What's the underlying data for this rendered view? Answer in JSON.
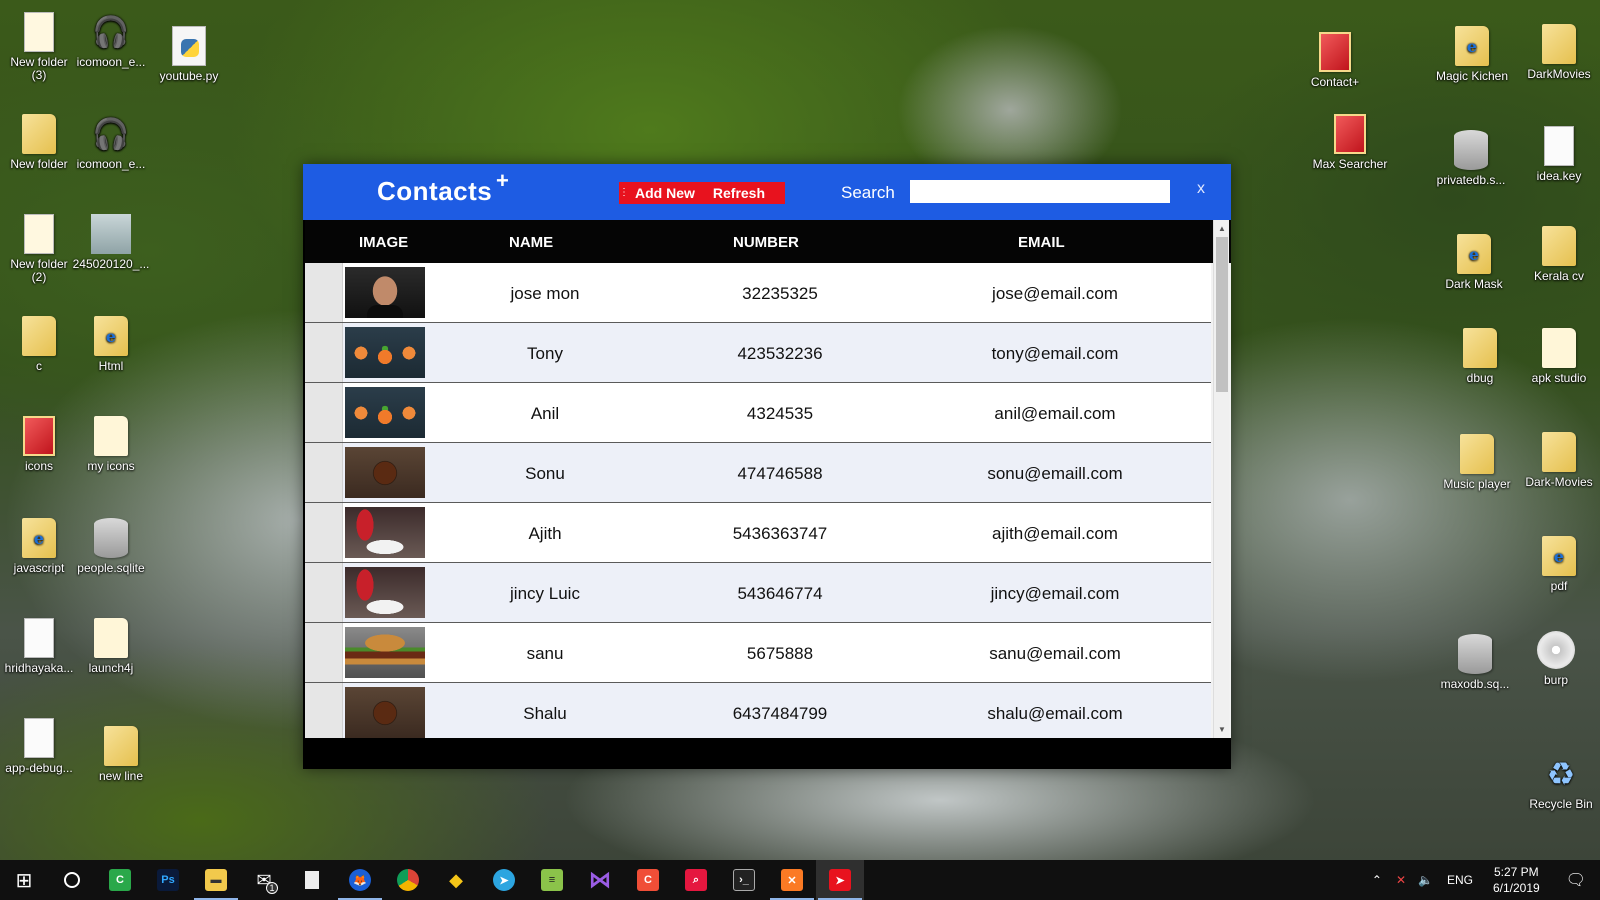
{
  "desktop": {
    "left_icons": [
      {
        "label": "New folder\n(3)",
        "icon": "folder-icon"
      },
      {
        "label": "icomoon_e...",
        "icon": "headphones-icon"
      },
      {
        "label": "youtube.py",
        "icon": "python-file-icon"
      },
      {
        "label": "New folder",
        "icon": "folder-icon"
      },
      {
        "label": "icomoon_e...",
        "icon": "headphones-icon"
      },
      {
        "label": "New folder\n(2)",
        "icon": "folder-icon"
      },
      {
        "label": "245020120_...",
        "icon": "photo-icon"
      },
      {
        "label": "c",
        "icon": "folder-icon"
      },
      {
        "label": "Html",
        "icon": "folder-ie-icon"
      },
      {
        "label": "icons",
        "icon": "red-folder-icon"
      },
      {
        "label": "my icons",
        "icon": "folder-icon"
      },
      {
        "label": "javascript",
        "icon": "folder-ie-icon"
      },
      {
        "label": "people.sqlite",
        "icon": "database-icon"
      },
      {
        "label": "hridhayaka...",
        "icon": "file-icon"
      },
      {
        "label": "launch4j",
        "icon": "folder-icon"
      },
      {
        "label": "app-debug...",
        "icon": "file-icon"
      },
      {
        "label": "new line",
        "icon": "folder-icon"
      }
    ],
    "right_icons": [
      {
        "label": "Contact+",
        "icon": "red-folder-icon"
      },
      {
        "label": "Magic Kichen",
        "icon": "folder-ie-icon"
      },
      {
        "label": "DarkMovies",
        "icon": "folder-icon"
      },
      {
        "label": "Max Searcher",
        "icon": "red-folder-icon"
      },
      {
        "label": "privatedb.s...",
        "icon": "database-icon"
      },
      {
        "label": "idea.key",
        "icon": "file-icon"
      },
      {
        "label": "Dark Mask",
        "icon": "folder-ie-icon"
      },
      {
        "label": "Kerala cv",
        "icon": "folder-icon"
      },
      {
        "label": "dbug",
        "icon": "folder-icon"
      },
      {
        "label": "apk studio",
        "icon": "folder-icon"
      },
      {
        "label": "Music player",
        "icon": "folder-icon"
      },
      {
        "label": "Dark-Movies",
        "icon": "folder-icon"
      },
      {
        "label": "pdf",
        "icon": "folder-ie-icon"
      },
      {
        "label": "maxodb.sq...",
        "icon": "database-icon"
      },
      {
        "label": "burp",
        "icon": "cd-icon"
      },
      {
        "label": "Recycle Bin",
        "icon": "recycle-bin-icon"
      }
    ]
  },
  "app": {
    "title": "Contacts",
    "plus": "+",
    "add_new_label": "Add New",
    "refresh_label": "Refresh",
    "search_label": "Search",
    "search_value": "",
    "close_label": "x",
    "columns": [
      "IMAGE",
      "NAME",
      "NUMBER",
      "EMAIL"
    ],
    "rows": [
      {
        "image": "portrait",
        "name": "jose mon",
        "number": "32235325",
        "email": "jose@email.com"
      },
      {
        "image": "shrimp",
        "name": "Tony",
        "number": "423532236",
        "email": "tony@email.com"
      },
      {
        "image": "shrimp",
        "name": "Anil",
        "number": "4324535",
        "email": "anil@email.com"
      },
      {
        "image": "bowl",
        "name": "Sonu",
        "number": "474746588",
        "email": "sonu@emaill.com"
      },
      {
        "image": "dinner",
        "name": "Ajith",
        "number": "5436363747",
        "email": "ajith@email.com"
      },
      {
        "image": "dinner",
        "name": "jincy Luic",
        "number": "543646774",
        "email": "jincy@email.com"
      },
      {
        "image": "burger",
        "name": "sanu",
        "number": "5675888",
        "email": "sanu@email.com"
      },
      {
        "image": "bowl",
        "name": "Shalu",
        "number": "6437484799",
        "email": "shalu@email.com"
      }
    ],
    "colors": {
      "titlebar": "#1e5ce3",
      "button_group": "#e8121e",
      "header": "#050505"
    }
  },
  "taskbar": {
    "items": [
      "windows-start-icon",
      "cortana-icon",
      "camtasia-icon",
      "photoshop-icon",
      "file-explorer-icon",
      "mail-icon",
      "file-icon",
      "firefox-icon",
      "chrome-icon",
      "sketch-icon",
      "telegram-icon",
      "notepad-icon",
      "visual-studio-icon",
      "codeblocks-icon",
      "search-app-icon",
      "terminal-icon",
      "xampp-icon",
      "contacts-app-icon"
    ],
    "mail_badge": "1",
    "tray_language": "ENG",
    "time": "5:27 PM",
    "date": "6/1/2019"
  }
}
